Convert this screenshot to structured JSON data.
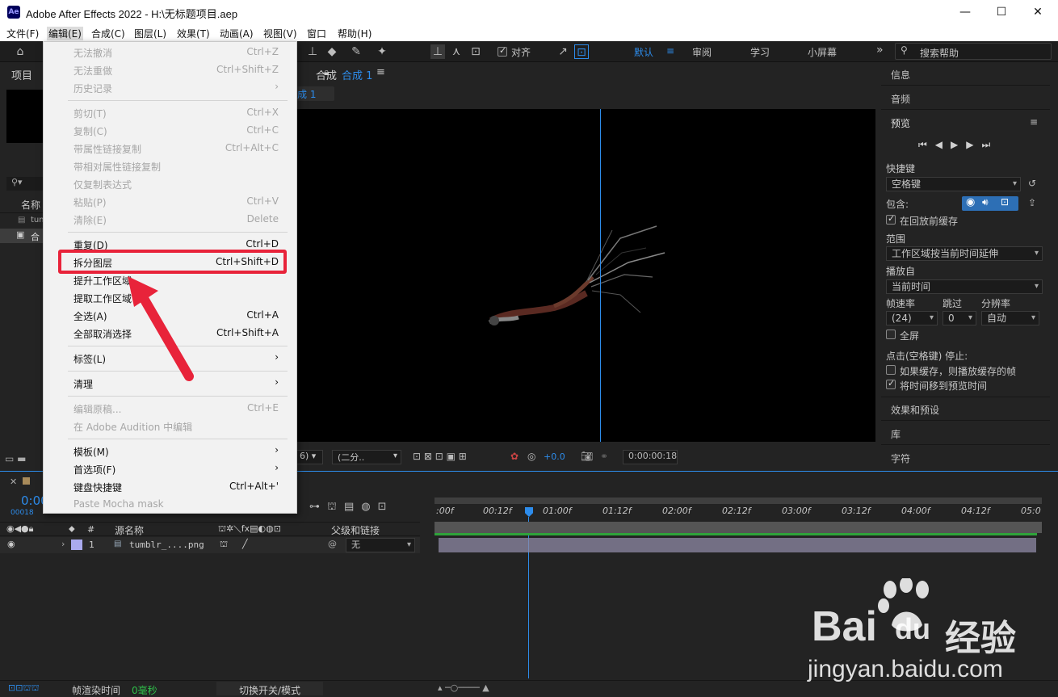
{
  "titlebar": {
    "app_icon": "Ae",
    "title": "Adobe After Effects 2022 - H:\\无标题项目.aep",
    "minimize": "—",
    "maximize": "☐",
    "close": "✕"
  },
  "menubar": {
    "items": [
      "文件(F)",
      "编辑(E)",
      "合成(C)",
      "图层(L)",
      "效果(T)",
      "动画(A)",
      "视图(V)",
      "窗口",
      "帮助(H)"
    ]
  },
  "toolbar": {
    "snap_label": "对齐",
    "workspaces": [
      "默认",
      "审阅",
      "学习",
      "小屏幕"
    ],
    "overflow": "»",
    "search_placeholder": "搜索帮助"
  },
  "project_panel": {
    "tab": "项目",
    "name_col": "名称",
    "items": [
      "tum",
      "合"
    ]
  },
  "composition_panel": {
    "prefix": "合成",
    "comp_name": "合成 1",
    "crumb": "成 1",
    "resolution": "(二分..",
    "zoom_suffix": "6)",
    "exposure": "+0.0",
    "timecode": "0:00:00:18"
  },
  "edit_menu": {
    "items": [
      {
        "label": "无法撤消",
        "shortcut": "Ctrl+Z",
        "disabled": true
      },
      {
        "label": "无法重做",
        "shortcut": "Ctrl+Shift+Z",
        "disabled": true
      },
      {
        "label": "历史记录",
        "shortcut": "",
        "disabled": true,
        "submenu": true
      },
      {
        "label": "剪切(T)",
        "shortcut": "Ctrl+X",
        "disabled": true
      },
      {
        "label": "复制(C)",
        "shortcut": "Ctrl+C",
        "disabled": true
      },
      {
        "label": "带属性链接复制",
        "shortcut": "Ctrl+Alt+C",
        "disabled": true
      },
      {
        "label": "带相对属性链接复制",
        "shortcut": "",
        "disabled": true
      },
      {
        "label": "仅复制表达式",
        "shortcut": "",
        "disabled": true
      },
      {
        "label": "粘贴(P)",
        "shortcut": "Ctrl+V",
        "disabled": true
      },
      {
        "label": "清除(E)",
        "shortcut": "Delete",
        "disabled": true
      },
      {
        "label": "重复(D)",
        "shortcut": "Ctrl+D",
        "disabled": false
      },
      {
        "label": "拆分图层",
        "shortcut": "Ctrl+Shift+D",
        "disabled": false
      },
      {
        "label": "提升工作区域",
        "shortcut": "",
        "disabled": false
      },
      {
        "label": "提取工作区域",
        "shortcut": "",
        "disabled": false
      },
      {
        "label": "全选(A)",
        "shortcut": "Ctrl+A",
        "disabled": false
      },
      {
        "label": "全部取消选择",
        "shortcut": "Ctrl+Shift+A",
        "disabled": false
      },
      {
        "label": "标签(L)",
        "shortcut": "",
        "disabled": false,
        "submenu": true
      },
      {
        "label": "清理",
        "shortcut": "",
        "disabled": false,
        "submenu": true
      },
      {
        "label": "编辑原稿...",
        "shortcut": "Ctrl+E",
        "disabled": true
      },
      {
        "label": "在 Adobe Audition 中编辑",
        "shortcut": "",
        "disabled": true
      },
      {
        "label": "模板(M)",
        "shortcut": "",
        "disabled": false,
        "submenu": true
      },
      {
        "label": "首选项(F)",
        "shortcut": "",
        "disabled": false,
        "submenu": true
      },
      {
        "label": "键盘快捷键",
        "shortcut": "Ctrl+Alt+'",
        "disabled": false
      },
      {
        "label": "Paste Mocha mask",
        "shortcut": "",
        "disabled": true
      }
    ],
    "submenu_arrow": "›",
    "highlight_color": "#e8233a"
  },
  "right_panel": {
    "info": "信息",
    "audio": "音频",
    "preview": "预览",
    "menu_icon": "≡",
    "shortcut_label": "快捷键",
    "shortcut_value": "空格键",
    "include_label": "包含:",
    "cache_before": "在回放前缓存",
    "range_label": "范围",
    "range_value": "工作区域按当前时间延伸",
    "play_from_label": "播放自",
    "play_from_value": "当前时间",
    "fps_label": "帧速率",
    "fps_value": "(24)",
    "skip_label": "跳过",
    "skip_value": "0",
    "res_label": "分辨率",
    "res_value": "自动",
    "fullscreen": "全屏",
    "stop_label": "点击(空格键) 停止:",
    "if_cached": "如果缓存，则播放缓存的帧",
    "move_time": "将时间移到预览时间",
    "effects": "效果和预设",
    "library": "库",
    "character": "字符"
  },
  "timeline": {
    "timecode": "0:00",
    "frame": "00018",
    "columns": {
      "source_name": "源名称",
      "parent": "父级和链接",
      "num": "#"
    },
    "ruler": [
      ":00f",
      "00:12f",
      "01:00f",
      "01:12f",
      "02:00f",
      "02:12f",
      "03:00f",
      "03:12f",
      "04:00f",
      "04:12f",
      "05:0"
    ],
    "layer": {
      "num": "1",
      "name": "tumblr_....png",
      "parent": "无"
    },
    "footer": {
      "render_label": "帧渲染时间",
      "render_value": "0毫秒",
      "toggle": "切换开关/模式"
    }
  },
  "watermark": {
    "brand": "Bai",
    "brand2": "du",
    "cn": "经验",
    "url": "jingyan.baidu.com"
  }
}
